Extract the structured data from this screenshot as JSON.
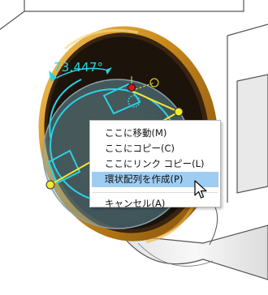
{
  "viewport": {
    "angle_readout": "73.447°",
    "colors": {
      "background": "#ffffff",
      "part_outline": "#555555",
      "part_face_shadow": "#d9d9d9",
      "disk_dark": "#1c130a",
      "gold_rim": "#c8871a",
      "manipulator_cyan": "#29d3e6",
      "handle_yellow": "#f2ea2e",
      "grab_point_red": "#d11a1a"
    }
  },
  "context_menu": {
    "items": [
      {
        "label": "ここに移動(M)",
        "highlighted": false
      },
      {
        "label": "ここにコピー(C)",
        "highlighted": false
      },
      {
        "label": "ここにリンク コピー(L)",
        "highlighted": false
      },
      {
        "label": "環状配列を作成(P)",
        "highlighted": true
      },
      {
        "label": "キャンセル(A)",
        "highlighted": false
      }
    ]
  }
}
